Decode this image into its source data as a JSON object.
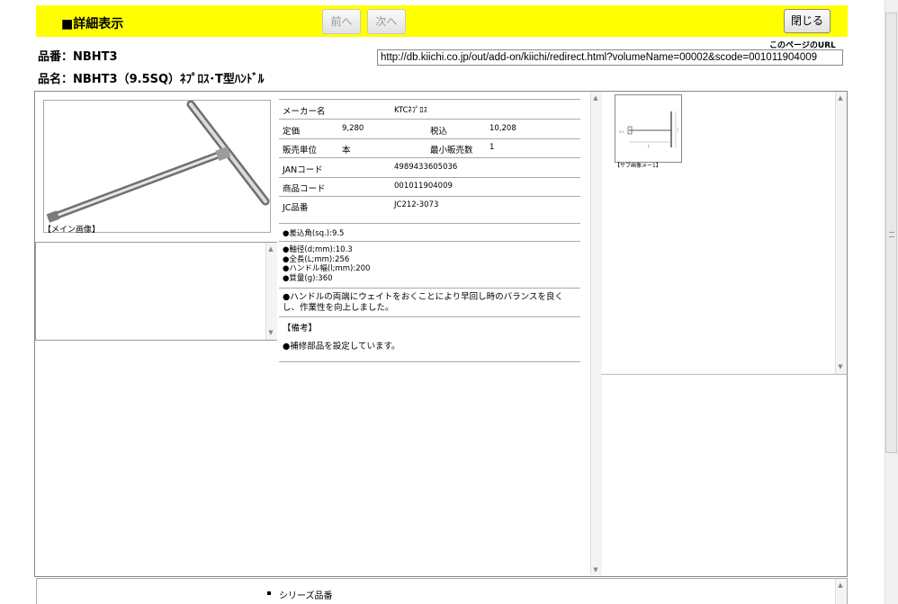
{
  "header": {
    "title": "■詳細表示",
    "prev_label": "前へ",
    "next_label": "次へ",
    "close_label": "閉じる"
  },
  "product": {
    "number_line": "品番：NBHT3",
    "name_line": "品名：NBHT3（9.5SQ）ﾈﾌﾟﾛｽ･T型ﾊﾝﾄﾞﾙ"
  },
  "page_url": {
    "label": "このページのURL",
    "value": "http://db.kiichi.co.jp/out/add-on/kiichi/redirect.html?volumeName=00002&scode=001011904009"
  },
  "images": {
    "main_caption": "【メイン画像】",
    "sub_caption": "【サブ画像メー1】"
  },
  "specs": {
    "maker_label": "メーカー名",
    "maker_value": "KTCﾈﾌﾟﾛｽ",
    "price_label": "定価",
    "price_value": "9,280",
    "tax_label": "税込",
    "tax_value": "10,208",
    "unit_label": "販売単位",
    "unit_value": "本",
    "min_label": "最小販売数",
    "min_value": "1",
    "jan_label": "JANコード",
    "jan_value": "4989433605036",
    "code_label": "商品コード",
    "code_value": "001011904009",
    "jc_label": "JC品番",
    "jc_value": "JC212-3073"
  },
  "details": {
    "square_drive": "●差込角(sq.):9.5",
    "dims": [
      "●軸径(d;mm):10.3",
      "●全長(L;mm):256",
      "●ハンドル幅(l;mm):200",
      "●質量(g):360"
    ],
    "desc_line1": "●ハンドルの両端にウェイトをおくことにより早回し時のバランスを良く",
    "desc_line2": "し、作業性を向上しました。",
    "remarks_label": "【備考】",
    "remarks_text": "●補修部品を設定しています。"
  },
  "series": {
    "label": "シリーズ品番"
  },
  "icons": {
    "scroll_up": "scroll-up-arrow",
    "scroll_down": "scroll-down-arrow",
    "bullet": "square-bullet"
  }
}
